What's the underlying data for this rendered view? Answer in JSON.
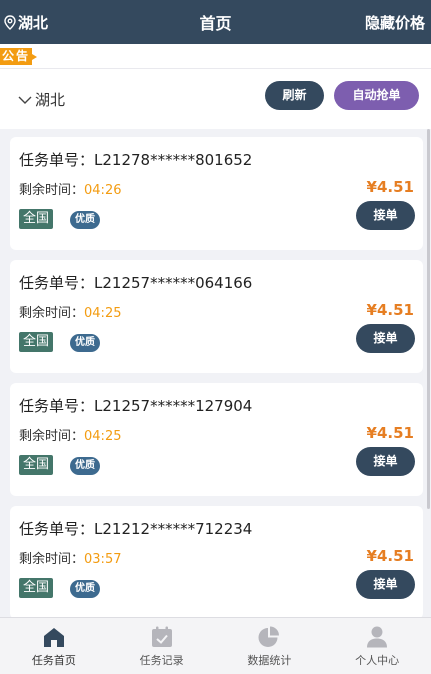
{
  "header": {
    "location": "湖北",
    "title": "首页",
    "right_action": "隐藏价格"
  },
  "notice": {
    "badge": "公告"
  },
  "toolbar": {
    "region": "湖北",
    "refresh_label": "刷新",
    "auto_label": "自动抢单"
  },
  "tasks": [
    {
      "task_no": "任务单号：L21278******801652",
      "remain_label": "剩余时间：",
      "remain_time": "04:26",
      "price": "¥4.51",
      "region_tag": "全国",
      "quality_tag": "优质",
      "accept_label": "接单"
    },
    {
      "task_no": "任务单号：L21257******064166",
      "remain_label": "剩余时间：",
      "remain_time": "04:25",
      "price": "¥4.51",
      "region_tag": "全国",
      "quality_tag": "优质",
      "accept_label": "接单"
    },
    {
      "task_no": "任务单号：L21257******127904",
      "remain_label": "剩余时间：",
      "remain_time": "04:25",
      "price": "¥4.51",
      "region_tag": "全国",
      "quality_tag": "优质",
      "accept_label": "接单"
    },
    {
      "task_no": "任务单号：L21212******712234",
      "remain_label": "剩余时间：",
      "remain_time": "03:57",
      "price": "¥4.51",
      "region_tag": "全国",
      "quality_tag": "优质",
      "accept_label": "接单"
    }
  ],
  "tabbar": [
    {
      "label": "任务首页",
      "icon": "home-icon",
      "active": true
    },
    {
      "label": "任务记录",
      "icon": "calendar-check-icon",
      "active": false
    },
    {
      "label": "数据统计",
      "icon": "pie-chart-icon",
      "active": false
    },
    {
      "label": "个人中心",
      "icon": "user-icon",
      "active": false
    }
  ],
  "colors": {
    "header_bg": "#34495e",
    "accent_orange": "#f39c12",
    "price": "#e67e22",
    "auto_button": "#7d5eaf",
    "region_tag": "#44766a",
    "quality_tag": "#3d6a8f"
  }
}
